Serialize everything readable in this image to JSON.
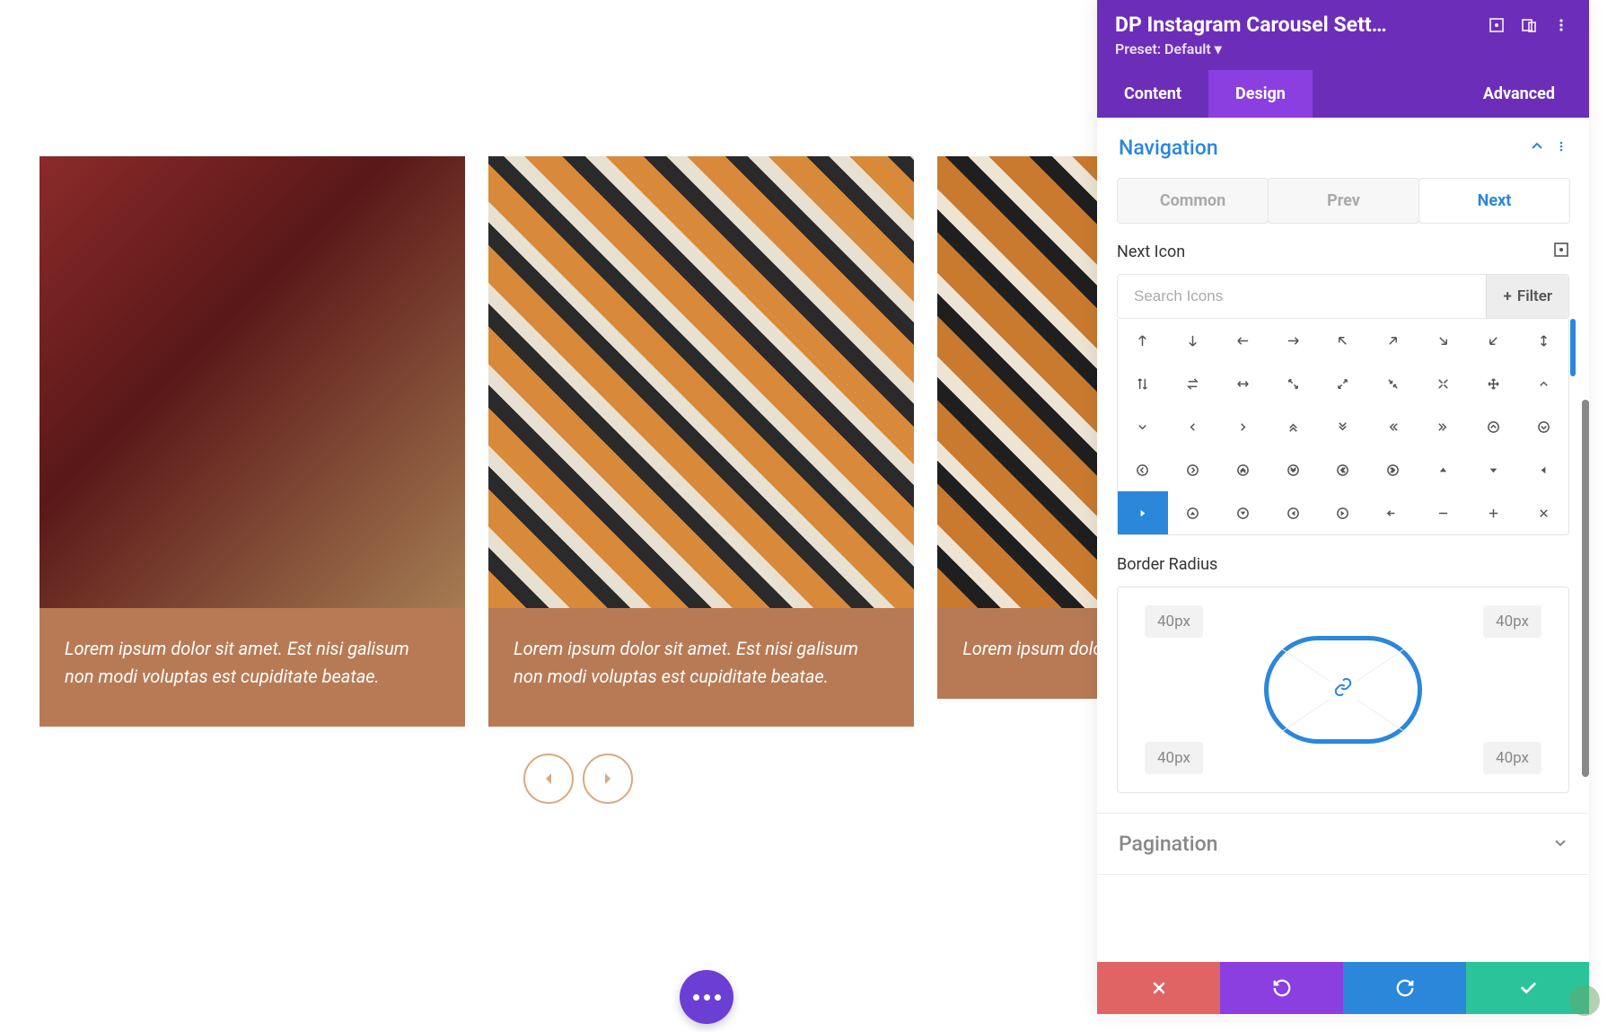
{
  "carousel": {
    "items": [
      {
        "caption": "Lorem ipsum dolor sit amet. Est nisi galisum non modi voluptas est cupiditate beatae."
      },
      {
        "caption": "Lorem ipsum dolor sit amet. Est nisi galisum non modi voluptas est cupiditate beatae."
      },
      {
        "caption": "Lorem ipsum dolor sit amet. Est nisi galisum non modi voluptas est cupiditate beatae."
      }
    ]
  },
  "panel": {
    "title": "DP Instagram Carousel Sett…",
    "preset": "Preset: Default ▾",
    "tabs": {
      "content": "Content",
      "design": "Design",
      "advanced": "Advanced",
      "active": "design"
    },
    "sections": {
      "navigation": {
        "title": "Navigation",
        "expanded": true,
        "subtabs": {
          "common": "Common",
          "prev": "Prev",
          "next": "Next",
          "active": "next"
        },
        "next_icon": {
          "label": "Next Icon",
          "search_placeholder": "Search Icons",
          "filter_label": "Filter"
        },
        "border_radius": {
          "label": "Border Radius",
          "tl": "40px",
          "tr": "40px",
          "bl": "40px",
          "br": "40px"
        }
      },
      "pagination": {
        "title": "Pagination",
        "expanded": false
      }
    }
  },
  "colors": {
    "accent": "#2b87da",
    "brand": "#b87a55",
    "panel_primary": "#6c2eb9",
    "panel_active": "#8b3fe0"
  }
}
